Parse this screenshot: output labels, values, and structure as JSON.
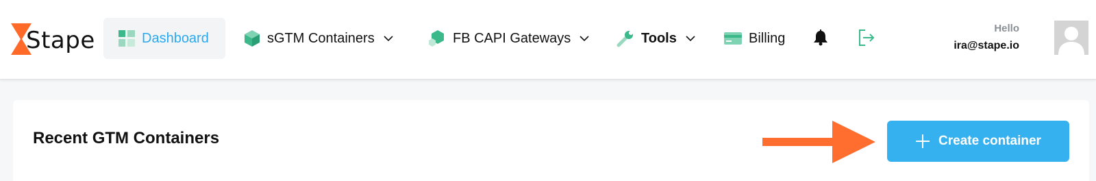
{
  "brand": {
    "name": "Stape"
  },
  "nav": {
    "dashboard": "Dashboard",
    "sgtm": "sGTM Containers",
    "fbcapi": "FB CAPI Gateways",
    "tools": "Tools",
    "billing": "Billing"
  },
  "user": {
    "greeting": "Hello",
    "email": "ira@stape.io"
  },
  "main": {
    "title": "Recent GTM Containers",
    "create_label": "Create container"
  },
  "colors": {
    "accent": "#35b1ef",
    "active_text": "#2aa9ee",
    "green": "#3cb98b",
    "arrow": "#ff6e2e",
    "logo_orange": "#ff6a28"
  },
  "icons": [
    "dashboard-icon",
    "cube-icon",
    "cubes-icon",
    "wrench-icon",
    "credit-card-icon",
    "bell-icon",
    "logout-icon",
    "plus-icon"
  ]
}
